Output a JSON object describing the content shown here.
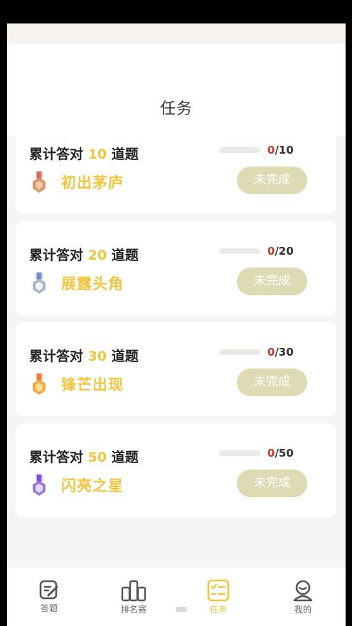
{
  "header": {
    "title": "任务"
  },
  "tasks": [
    {
      "prefix": "累计答对",
      "number": "10",
      "suffix": "道题",
      "current": "0",
      "total": "/10",
      "progress": 0,
      "medal_icon": "bronze-medal-icon",
      "medal_color": "#d9956b",
      "badge": "初出茅庐",
      "status": "未完成"
    },
    {
      "prefix": "累计答对",
      "number": "20",
      "suffix": "道题",
      "current": "0",
      "total": "/20",
      "progress": 0,
      "medal_icon": "silver-medal-icon",
      "medal_color": "#a9b4c6",
      "badge": "展露头角",
      "status": "未完成"
    },
    {
      "prefix": "累计答对",
      "number": "30",
      "suffix": "道题",
      "current": "0",
      "total": "/30",
      "progress": 0,
      "medal_icon": "gold-medal-icon",
      "medal_color": "#f0a84a",
      "badge": "锋芒出现",
      "status": "未完成"
    },
    {
      "prefix": "累计答对",
      "number": "50",
      "suffix": "道题",
      "current": "0",
      "total": "/50",
      "progress": 0,
      "medal_icon": "purple-medal-icon",
      "medal_color": "#9a7ad9",
      "badge": "闪亮之星",
      "status": "未完成"
    }
  ],
  "tabbar": {
    "items": [
      {
        "label": "答题",
        "icon": "answer-icon"
      },
      {
        "label": "排名赛",
        "icon": "ranking-icon"
      },
      {
        "label": "任务",
        "icon": "task-icon",
        "active": true
      },
      {
        "label": "我的",
        "icon": "profile-icon"
      }
    ]
  },
  "colors": {
    "accent": "#f2c53d",
    "status_bg": "#dcdbb4",
    "count_red": "#c23a2b"
  }
}
